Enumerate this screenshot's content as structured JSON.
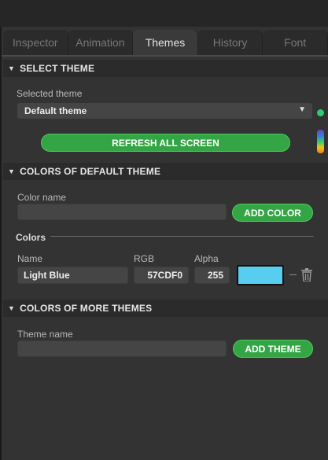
{
  "tabs": [
    {
      "label": "Inspector",
      "active": false
    },
    {
      "label": "Animation",
      "active": false
    },
    {
      "label": "Themes",
      "active": true
    },
    {
      "label": "History",
      "active": false
    },
    {
      "label": "Font",
      "active": false
    }
  ],
  "select_theme": {
    "header": "SELECT THEME",
    "selected_label": "Selected theme",
    "selected_value": "Default theme",
    "refresh_button": "REFRESH ALL SCREEN"
  },
  "colors_default": {
    "header": "COLORS OF DEFAULT THEME",
    "color_name_label": "Color name",
    "color_name_value": "",
    "add_color_button": "ADD COLOR",
    "colors_group_label": "Colors",
    "col_name": "Name",
    "col_rgb": "RGB",
    "col_alpha": "Alpha",
    "rows": [
      {
        "name": "Light Blue",
        "rgb": "57CDF0",
        "alpha": "255",
        "swatch": "#57CDF0"
      }
    ]
  },
  "colors_more": {
    "header": "COLORS OF MORE THEMES",
    "theme_name_label": "Theme name",
    "theme_name_value": "",
    "add_theme_button": "ADD THEME"
  },
  "accent_colors": {
    "green": "#33A544",
    "status_dot": "#2ECC71"
  }
}
